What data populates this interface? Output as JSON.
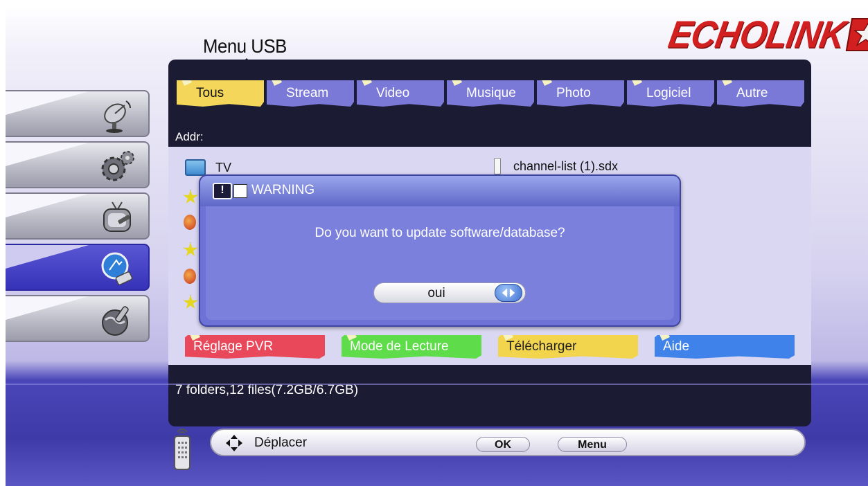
{
  "header": {
    "title": "Menu USB",
    "brand": "ECHOLINK"
  },
  "sidebar": {
    "items": [
      {
        "name": "satellite",
        "icon": "satellite-dish-icon",
        "active": false
      },
      {
        "name": "settings",
        "icon": "gears-icon",
        "active": false
      },
      {
        "name": "tv",
        "icon": "tv-icon",
        "active": false
      },
      {
        "name": "usb",
        "icon": "usb-icon",
        "active": true
      },
      {
        "name": "network",
        "icon": "globe-icon",
        "active": false
      }
    ]
  },
  "tabs": [
    {
      "label": "Tous",
      "active": true
    },
    {
      "label": "Stream",
      "active": false
    },
    {
      "label": "Video",
      "active": false
    },
    {
      "label": "Musique",
      "active": false
    },
    {
      "label": "Photo",
      "active": false
    },
    {
      "label": "Logiciel",
      "active": false
    },
    {
      "label": "Autre",
      "active": false
    }
  ],
  "addr_label": "Addr:",
  "files": {
    "left": [
      {
        "name": "TV",
        "icon": "tv-folder-icon"
      }
    ],
    "right": [
      {
        "name": "channel-list (1).sdx",
        "icon": "file-icon"
      }
    ]
  },
  "color_buttons": [
    {
      "label": "Réglage PVR",
      "color": "#e8485a"
    },
    {
      "label": "Mode de Lecture",
      "color": "#5fdc4a"
    },
    {
      "label": "Télécharger",
      "color": "#f2d54c"
    },
    {
      "label": "Aide",
      "color": "#3f82ea"
    }
  ],
  "status": "7 folders,12 files(7.2GB/6.7GB)",
  "dialog": {
    "title": "WARNING",
    "message": "Do you want to update software/database?",
    "value": "oui"
  },
  "footer": {
    "move_label": "Déplacer",
    "ok_label": "OK",
    "menu_label": "Menu"
  }
}
